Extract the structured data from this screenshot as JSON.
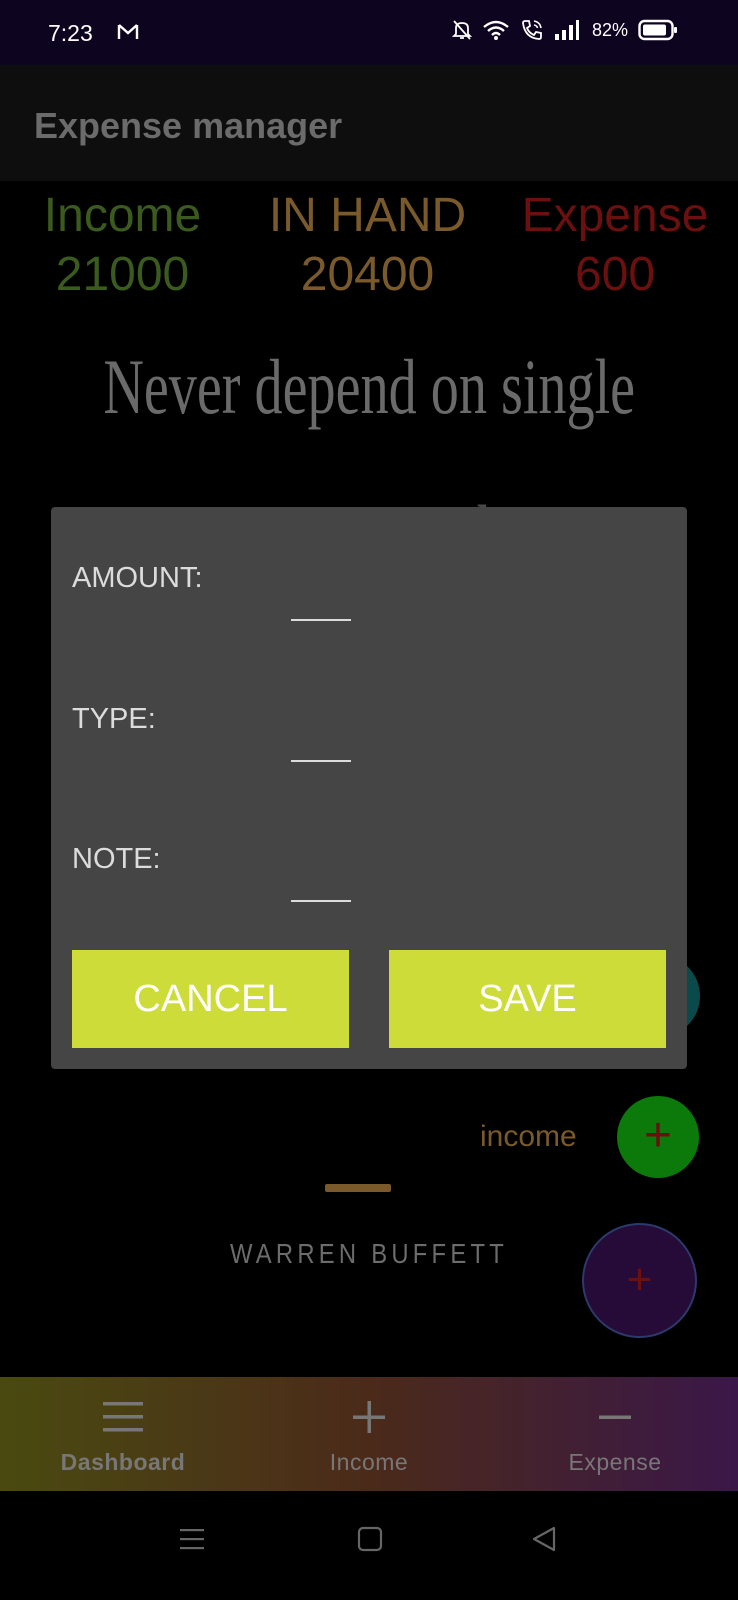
{
  "status_bar": {
    "time": "7:23",
    "battery": "82%",
    "icons": [
      "gmail-icon",
      "bell-off-icon",
      "wifi-icon",
      "wifi-call-icon",
      "signal-icon",
      "battery-icon"
    ]
  },
  "app_bar": {
    "title": "Expense manager"
  },
  "summary": {
    "income_label": "Income",
    "income_value": "21000",
    "in_hand_label": "IN HAND",
    "in_hand_value": "20400",
    "expense_label": "Expense",
    "expense_value": "600"
  },
  "quote": {
    "line1": "Never depend on single",
    "line2": "income. Make",
    "author": "WARREN BUFFETT"
  },
  "fab": {
    "income_label": "income",
    "income_icon": "+",
    "main_icon": "+"
  },
  "dialog": {
    "amount_label": "AMOUNT:",
    "amount_value": "",
    "type_label": "TYPE:",
    "type_value": "",
    "note_label": "NOTE:",
    "note_value": "",
    "cancel_label": "CANCEL",
    "save_label": "SAVE"
  },
  "bottom_nav": {
    "items": [
      {
        "label": "Dashboard",
        "icon": "menu-icon"
      },
      {
        "label": "Income",
        "icon": "plus-icon"
      },
      {
        "label": "Expense",
        "icon": "minus-icon"
      }
    ]
  },
  "colors": {
    "accent_button": "#cddc39",
    "income": "#3b5a1d",
    "in_hand": "#7a5a2a",
    "expense": "#6c0f0f",
    "dialog_bg": "#454545"
  }
}
